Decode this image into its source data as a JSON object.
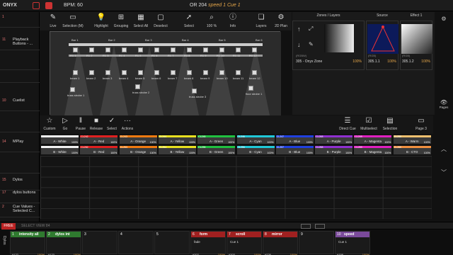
{
  "app": {
    "name": "ONYX",
    "bpm": "BPM: 60",
    "show": "OR 204",
    "speed": "speed 1",
    "cue": "Cue 1"
  },
  "cuelist": [
    {
      "n": "1",
      "label": ""
    },
    {
      "n": "11",
      "label": "Playback Buttons - ..."
    },
    {
      "n": "",
      "label": ""
    },
    {
      "n": "",
      "label": ""
    },
    {
      "n": "10",
      "label": "Cuelist"
    },
    {
      "n": "",
      "label": ""
    },
    {
      "n": "14",
      "label": "MPlay"
    },
    {
      "n": "",
      "label": ""
    },
    {
      "n": "15",
      "label": "Dylos"
    },
    {
      "n": "17",
      "label": "dylos buttons"
    },
    {
      "n": "2",
      "label": "Cue Values - Selected C..."
    }
  ],
  "toolbar": [
    {
      "icon": "pencil-icon",
      "g": "✎",
      "label": "Live"
    },
    {
      "icon": "selection-icon",
      "g": "▭",
      "label": "Selection (M)"
    },
    {
      "icon": "bulb-icon",
      "g": "💡",
      "label": "Highlight"
    },
    {
      "icon": "grouping-icon",
      "g": "⊞",
      "label": "Grouping"
    },
    {
      "icon": "select-all-icon",
      "g": "▦",
      "label": "Select All"
    },
    {
      "icon": "deselect-icon",
      "g": "▢",
      "label": "Deselect"
    },
    {
      "icon": "pointer-icon",
      "g": "➚",
      "label": "Select"
    },
    {
      "icon": "zoom-icon",
      "g": "⌕",
      "label": "100 %"
    },
    {
      "icon": "info-icon",
      "g": "ⓘ",
      "label": "Info"
    },
    {
      "icon": "layers-icon",
      "g": "❏",
      "label": "Layers"
    },
    {
      "icon": "gear-icon",
      "g": "⚙",
      "label": "2D Plan"
    }
  ],
  "stage": {
    "bars": [
      "Bar 1",
      "Bar 2",
      "Bar 3",
      "Bar 4",
      "Bar 5",
      "Bar 6"
    ],
    "row1": [
      "R1 1",
      "R1 2",
      "R1 3",
      "R1 4",
      "R1 5",
      "R1 6",
      "R1 7",
      "R1 8",
      "R1 9",
      "R1 10",
      "R1 11",
      "R1 12"
    ],
    "beams": [
      "beam 1",
      "beam 2",
      "beam 3",
      "beam 4",
      "beam 5",
      "beam 6",
      "beam 7",
      "beam 8",
      "beam 9",
      "beam 10",
      "beam 11",
      "beam 12"
    ],
    "strobes": [
      "truss strobe 1",
      "truss strobe 2",
      "truss strobe 3",
      "floor strobe 1"
    ],
    "side_left": "R1 1R R1 3R",
    "side_right": "R1 5 R1 4R"
  },
  "right_panels": {
    "zones_title": "Zones / Layers",
    "zones_item": "305 - Onyx Zone",
    "zones_sub": "(RGBW)",
    "zones_pct": "100%",
    "source_title": "Source",
    "source_item": "305.1.1",
    "source_sub": "(RGB)",
    "source_pct": "100%",
    "effect_title": "Effect 1",
    "effect_item": "305.1.2",
    "effect_sub": "(RGB)",
    "effect_pct": "100%"
  },
  "right_icons": [
    {
      "icon": "gear-icon",
      "g": "⚙",
      "label": ""
    },
    {
      "icon": "eye-icon",
      "g": "👁",
      "label": "Pages"
    },
    {
      "icon": "chevron-up-icon",
      "g": "︿",
      "label": ""
    },
    {
      "icon": "chevron-down-icon",
      "g": "﹀",
      "label": ""
    }
  ],
  "cuebar": [
    {
      "icon": "star-icon",
      "g": "☆",
      "label": "Custom"
    },
    {
      "icon": "play-icon",
      "g": "▷",
      "label": "Go"
    },
    {
      "icon": "pause-icon",
      "g": "‖",
      "label": "Pause"
    },
    {
      "icon": "stop-icon",
      "g": "■",
      "label": "Release"
    },
    {
      "icon": "check-icon",
      "g": "✓",
      "label": "Select"
    },
    {
      "icon": "more-icon",
      "g": "···",
      "label": "Actions"
    }
  ],
  "cuebar_right": [
    {
      "icon": "direct-cue-icon",
      "g": "☰",
      "label": "Direct Cue"
    },
    {
      "icon": "multiselect-icon",
      "g": "☑",
      "label": "Multiselect"
    },
    {
      "icon": "selection-icon",
      "g": "▤",
      "label": "Selection"
    },
    {
      "icon": "page-icon",
      "g": "▭",
      "label": "Page 3"
    }
  ],
  "palette_a": [
    {
      "id": "CL241",
      "name": "A - White",
      "pct": "100%",
      "color": "#f0f0f0"
    },
    {
      "id": "CL242",
      "name": "A - Red",
      "pct": "100%",
      "color": "#e02020"
    },
    {
      "id": "CL243",
      "name": "A - Orange",
      "pct": "100%",
      "color": "#f07a10"
    },
    {
      "id": "CL244",
      "name": "A - Yellow",
      "pct": "100%",
      "color": "#e8e020"
    },
    {
      "id": "CL245",
      "name": "A - Green",
      "pct": "100%",
      "color": "#20c040"
    },
    {
      "id": "CL246",
      "name": "A - Cyan",
      "pct": "100%",
      "color": "#20c8d8"
    },
    {
      "id": "CL247",
      "name": "A - Blue",
      "pct": "100%",
      "color": "#2040e0"
    },
    {
      "id": "CL248",
      "name": "A - Purple",
      "pct": "100%",
      "color": "#9030d0"
    },
    {
      "id": "CL249",
      "name": "A - Magenta",
      "pct": "100%",
      "color": "#e020c0"
    },
    {
      "id": "CL250",
      "name": "A - Warm",
      "pct": "100%",
      "color": "#f0c070"
    }
  ],
  "palette_b": [
    {
      "id": "CL251",
      "name": "B - White",
      "pct": "100%",
      "color": "#f0f0f0"
    },
    {
      "id": "CL252",
      "name": "B - Red",
      "pct": "100%",
      "color": "#e02020"
    },
    {
      "id": "CL253",
      "name": "B - Orange",
      "pct": "100%",
      "color": "#f07a10"
    },
    {
      "id": "CL254",
      "name": "B - Yellow",
      "pct": "100%",
      "color": "#e8e020"
    },
    {
      "id": "CL255",
      "name": "B - Green",
      "pct": "100%",
      "color": "#20c040"
    },
    {
      "id": "CL256",
      "name": "B - Cyan",
      "pct": "100%",
      "color": "#20c8d8"
    },
    {
      "id": "CL257",
      "name": "B - Blue",
      "pct": "100%",
      "color": "#2040e0"
    },
    {
      "id": "CL258",
      "name": "B - Purple",
      "pct": "100%",
      "color": "#9030d0"
    },
    {
      "id": "CL259",
      "name": "B - Magenta",
      "pct": "100%",
      "color": "#e020c0"
    },
    {
      "id": "CL260",
      "name": "B - CTO",
      "pct": "100%",
      "color": "#f09040"
    }
  ],
  "command": {
    "free": "FREE",
    "text": "SELECT VIEW 84"
  },
  "playbacks": [
    {
      "n": "1",
      "name": "intensity all",
      "cue": "",
      "cid": "#122",
      "pct": "100%",
      "color": "#2f7a2f"
    },
    {
      "n": "2",
      "name": "dylos int",
      "cue": "",
      "cid": "#123",
      "pct": "100%",
      "color": "#2f7a2f"
    },
    {
      "n": "3",
      "name": "",
      "cue": "",
      "cid": "",
      "pct": "",
      "color": ""
    },
    {
      "n": "4",
      "name": "",
      "cue": "",
      "cid": "",
      "pct": "",
      "color": ""
    },
    {
      "n": "5",
      "name": "",
      "cue": "",
      "cid": "",
      "pct": "",
      "color": ""
    },
    {
      "n": "6",
      "name": "form",
      "cue": "fade",
      "cid": "#202",
      "pct": "100%",
      "color": "#a02020"
    },
    {
      "n": "7",
      "name": "scroll",
      "cue": "Cue 1",
      "cid": "#203",
      "pct": "100%",
      "color": "#a02020"
    },
    {
      "n": "8",
      "name": "mirror",
      "cue": "",
      "cid": "#226",
      "pct": "100%",
      "color": "#a02020"
    },
    {
      "n": "9",
      "name": "",
      "cue": "",
      "cid": "",
      "pct": "",
      "color": ""
    },
    {
      "n": "10",
      "name": "speed",
      "cue": "Cue 1",
      "cid": "#158",
      "pct": "100%",
      "color": "#7a4a9a"
    }
  ]
}
